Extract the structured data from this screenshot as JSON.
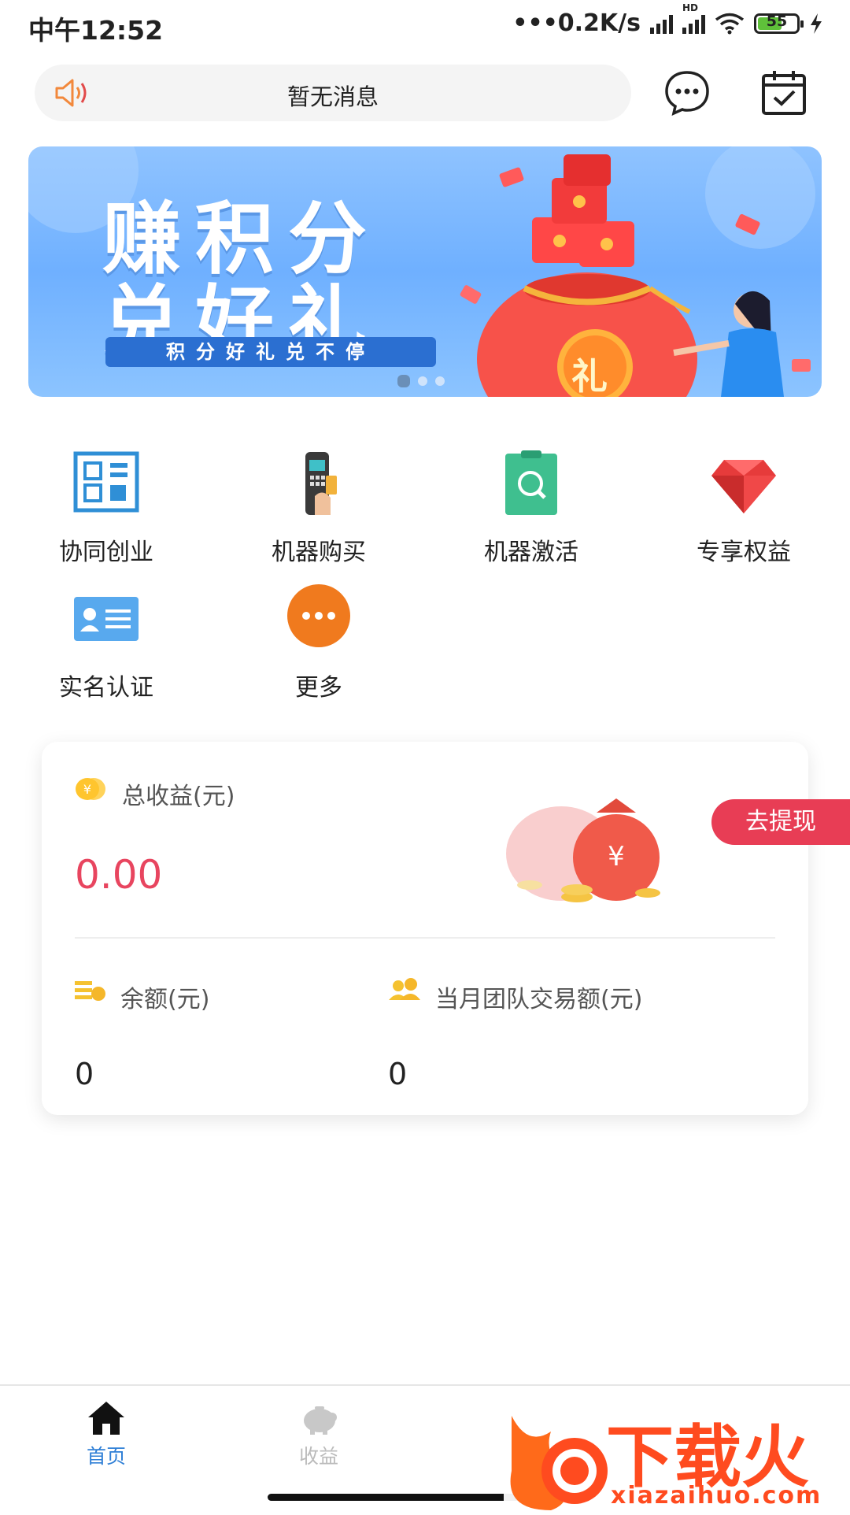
{
  "status_bar": {
    "time": "中午12:52",
    "network_speed": "•••0.2K/s",
    "hd_label": "HD",
    "battery": "55"
  },
  "header": {
    "notice_text": "暂无消息",
    "speaker_icon": "speaker-icon",
    "message_icon": "chat-bubble-icon",
    "checkin_icon": "calendar-check-icon"
  },
  "banner": {
    "title_line1": "赚积分",
    "title_line2": "兑好礼",
    "subtitle": "积分好礼兑不停",
    "gift_label": "礼",
    "page_count": 3,
    "active_page": 1
  },
  "grid": [
    {
      "label": "协同创业",
      "icon": "qr-code-icon",
      "color": "#2f8fd6"
    },
    {
      "label": "机器购买",
      "icon": "pos-terminal-icon",
      "color": "#333333"
    },
    {
      "label": "机器激活",
      "icon": "activate-clipboard-icon",
      "color": "#3fbf8f"
    },
    {
      "label": "专享权益",
      "icon": "ruby-gem-icon",
      "color": "#e63b3b"
    },
    {
      "label": "实名认证",
      "icon": "id-card-icon",
      "color": "#58a9ee"
    },
    {
      "label": "更多",
      "icon": "more-dots-icon",
      "color": "#f07a1e"
    }
  ],
  "earnings": {
    "total_label": "总收益(元)",
    "total_value": "0.00",
    "withdraw_label": "去提现",
    "balance_label": "余额(元)",
    "balance_value": "0",
    "team_label": "当月团队交易额(元)",
    "team_value": "0",
    "accent_color": "#e8455f"
  },
  "tabs": [
    {
      "label": "首页",
      "icon": "home-icon",
      "active": true
    },
    {
      "label": "收益",
      "icon": "piggy-bank-icon",
      "active": false
    }
  ],
  "watermark": {
    "brand": "下载火",
    "url": "xiazaihuo.com"
  }
}
